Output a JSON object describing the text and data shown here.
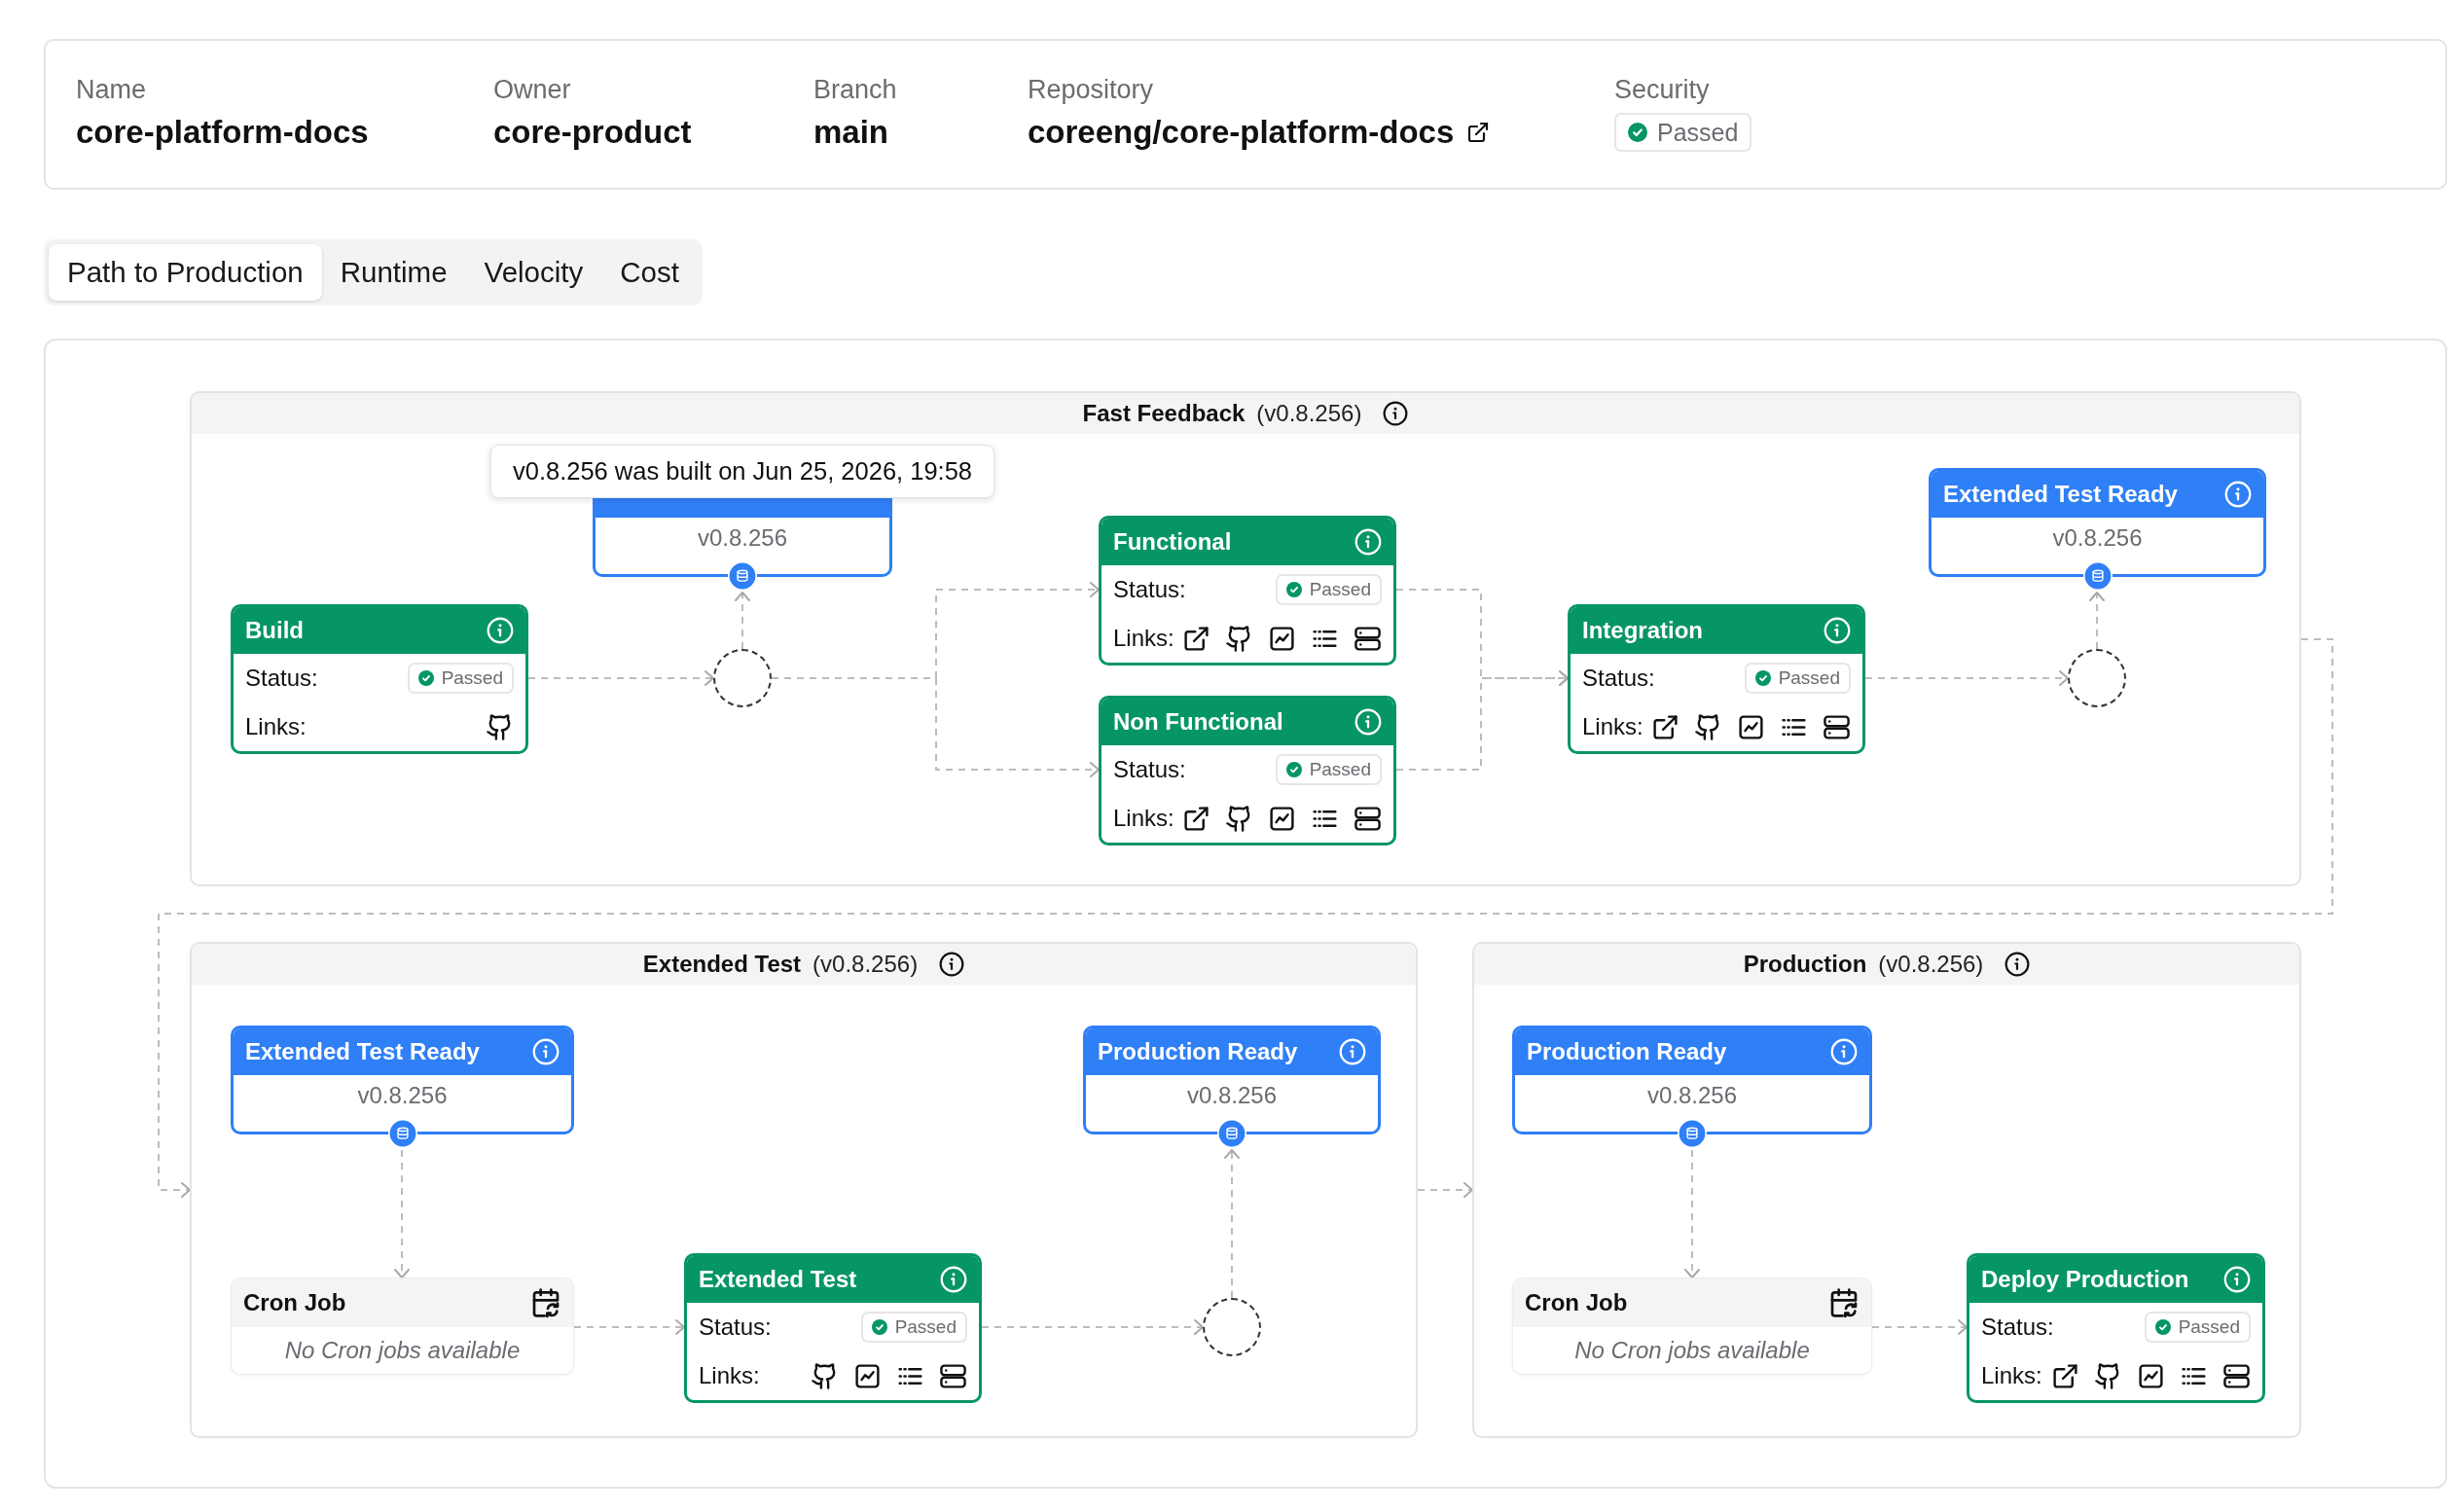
{
  "summary": [
    {
      "label": "Name",
      "kind": "text",
      "value": "core-platform-docs"
    },
    {
      "label": "Owner",
      "kind": "text",
      "value": "core-product"
    },
    {
      "label": "Branch",
      "kind": "text",
      "value": "main"
    },
    {
      "label": "Repository",
      "kind": "link",
      "value": "coreeng/core-platform-docs"
    },
    {
      "label": "Security",
      "kind": "status",
      "value": "Passed",
      "passed": true
    }
  ],
  "tabs": [
    {
      "label": "Path to Production",
      "selected": true
    },
    {
      "label": "Runtime",
      "selected": false
    },
    {
      "label": "Velocity",
      "selected": false
    },
    {
      "label": "Cost",
      "selected": false
    }
  ],
  "stages": [
    {
      "title": "Fast Feedback",
      "version": "(v0.8.256)",
      "nodes": [
        {
          "kind": "step",
          "title": "Build",
          "status_label": "Status:",
          "status": {
            "text": "Passed",
            "passed": true
          },
          "links_label": "Links:",
          "links": [
            {
              "kind": "github"
            }
          ]
        },
        {
          "kind": "gate",
          "version": "v0.8.256",
          "tooltip": "v0.8.256 was built on Jun 25, 2026, 19:58"
        },
        {
          "kind": "step",
          "title": "Functional",
          "status_label": "Status:",
          "status": {
            "text": "Passed",
            "passed": true
          },
          "links_label": "Links:",
          "links": [
            {
              "kind": "external"
            },
            {
              "kind": "github"
            },
            {
              "kind": "chart"
            },
            {
              "kind": "list"
            },
            {
              "kind": "server"
            }
          ]
        },
        {
          "kind": "step",
          "title": "Non Functional",
          "status_label": "Status:",
          "status": {
            "text": "Passed",
            "passed": true
          },
          "links_label": "Links:",
          "links": [
            {
              "kind": "external"
            },
            {
              "kind": "github"
            },
            {
              "kind": "chart"
            },
            {
              "kind": "list"
            },
            {
              "kind": "server"
            }
          ]
        },
        {
          "kind": "step",
          "title": "Integration",
          "status_label": "Status:",
          "status": {
            "text": "Passed",
            "passed": true
          },
          "links_label": "Links:",
          "links": [
            {
              "kind": "external"
            },
            {
              "kind": "github"
            },
            {
              "kind": "chart"
            },
            {
              "kind": "list"
            },
            {
              "kind": "server"
            }
          ]
        },
        {
          "kind": "gate",
          "title": "Extended Test Ready",
          "version": "v0.8.256"
        }
      ]
    },
    {
      "title": "Extended Test",
      "version": "(v0.8.256)",
      "nodes": [
        {
          "kind": "gate",
          "title": "Extended Test Ready",
          "version": "v0.8.256"
        },
        {
          "kind": "cron",
          "title": "Cron Job",
          "message": "No Cron jobs available"
        },
        {
          "kind": "step",
          "title": "Extended Test",
          "status_label": "Status:",
          "status": {
            "text": "Passed",
            "passed": true
          },
          "links_label": "Links:",
          "links": [
            {
              "kind": "github"
            },
            {
              "kind": "chart"
            },
            {
              "kind": "list"
            },
            {
              "kind": "server"
            }
          ]
        },
        {
          "kind": "gate",
          "title": "Production Ready",
          "version": "v0.8.256"
        }
      ]
    },
    {
      "title": "Production",
      "version": "(v0.8.256)",
      "nodes": [
        {
          "kind": "gate",
          "title": "Production Ready",
          "version": "v0.8.256"
        },
        {
          "kind": "cron",
          "title": "Cron Job",
          "message": "No Cron jobs available"
        },
        {
          "kind": "step",
          "title": "Deploy Production",
          "status_label": "Status:",
          "status": {
            "text": "Passed",
            "passed": true
          },
          "links_label": "Links:",
          "links": [
            {
              "kind": "external"
            },
            {
              "kind": "github"
            },
            {
              "kind": "chart"
            },
            {
              "kind": "list"
            },
            {
              "kind": "server"
            }
          ]
        }
      ]
    }
  ]
}
